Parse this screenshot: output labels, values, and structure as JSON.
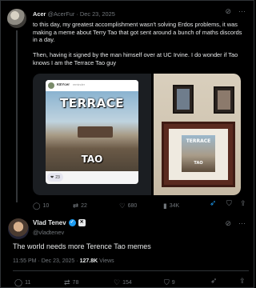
{
  "reply_post": {
    "author_name": "Acer",
    "handle": "@AcerFur",
    "separator": " · ",
    "date": "Dec 23, 2025",
    "paragraphs": [
      "to this day, my greatest accomplishment wasn't solving Erdos problems, it was making a meme about Terry Tao that got sent around a bunch of maths discords in a day.",
      "Then, having it signed by the man himself over at UC Irvine. I do wonder if Tao knows I am the Terrace Tao guy"
    ],
    "media": {
      "meme_card_name": "KEYcer",
      "meme_card_subtitle": "reminder",
      "meme_top_text": "TERRACE",
      "meme_bottom_text": "TAO",
      "meme_reaction_count": "23",
      "framed_top_text": "TERRACE",
      "framed_bottom_text": "TAO"
    },
    "stats": {
      "replies": "10",
      "reposts": "22",
      "likes": "680",
      "views": "34K"
    }
  },
  "main_post": {
    "author_name": "Vlad Tenev",
    "handle": "@vladtenev",
    "text": "The world needs more Terence Tao memes",
    "time": "11:55 PM",
    "separator": " · ",
    "date": "Dec 23, 2025",
    "separator2": " · ",
    "views_count": "127.8K",
    "views_label": " Views",
    "stats": {
      "replies": "11",
      "reposts": "78",
      "likes": "154",
      "bookmarks": "9"
    }
  },
  "colors": {
    "background": "#000000",
    "text_primary": "#e7e9ea",
    "text_secondary": "#71767b",
    "accent": "#1d9bf0",
    "divider": "#2f3336"
  },
  "icons": [
    "grok-icon",
    "more-icon",
    "reply-icon",
    "repost-icon",
    "like-icon",
    "views-icon",
    "boost-icon",
    "bookmark-icon",
    "share-icon",
    "verified-icon",
    "affiliate-badge-icon"
  ]
}
